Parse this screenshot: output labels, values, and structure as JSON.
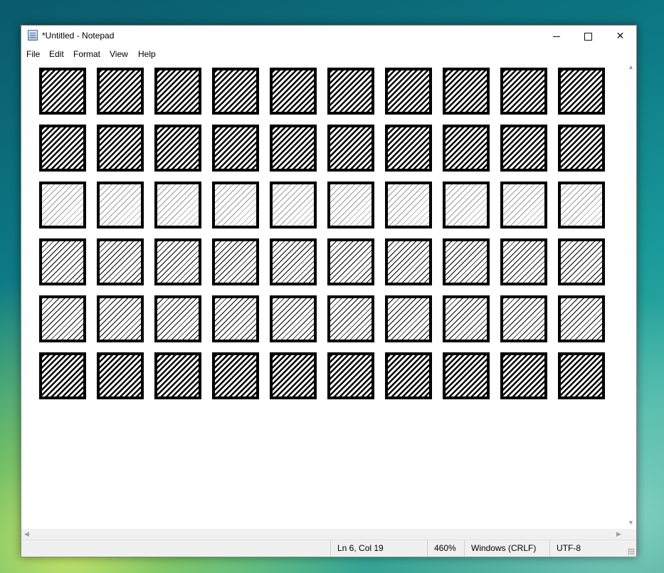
{
  "window": {
    "title": "*Untitled - Notepad",
    "icon": "notepad-icon",
    "controls": {
      "minimize_icon": "minimize-icon",
      "maximize_icon": "maximize-icon",
      "close_glyph": "✕"
    }
  },
  "menu": [
    "File",
    "Edit",
    "Format",
    "View",
    "Help"
  ],
  "editor": {
    "columns": 10,
    "rows": [
      "dense",
      "dense",
      "light",
      "fine",
      "fine",
      "dense"
    ],
    "content_description_icons": "hatched-square-glyph"
  },
  "scrollbars": {
    "up": "▲",
    "down": "▼",
    "left": "◀",
    "right": "▶"
  },
  "status": {
    "position": "Ln 6, Col 19",
    "zoom": "460%",
    "line_ending": "Windows (CRLF)",
    "encoding": "UTF-8"
  }
}
